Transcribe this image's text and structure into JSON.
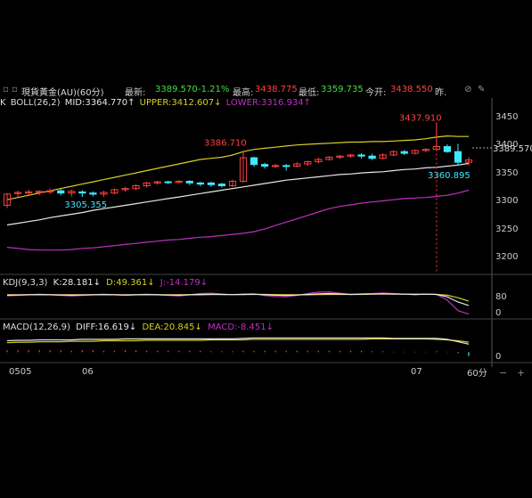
{
  "header": {
    "title": "現貨黃金(AU)(60分)",
    "latest_label": "最新:",
    "latest_value": "3389.570",
    "change_pct": "-1.21%",
    "high_label": "最高:",
    "high_value": "3438.775",
    "low_label": "最低:",
    "low_value": "3359.735",
    "open_label": "今开:",
    "open_value": "3438.550",
    "prev_label": "昨."
  },
  "boll_panel": {
    "k_label": "K",
    "title": "BOLL(26,2)",
    "mid": "MID:3364.770↑",
    "upper": "UPPER:3412.607↓",
    "lower": "LOWER:3316.934↑"
  },
  "kdj_panel": {
    "title": "KDJ(9,3,3)",
    "k": "K:28.181↓",
    "d": "D:49.361↓",
    "j": "J:-14.179↓"
  },
  "macd_panel": {
    "title": "MACD(12,26,9)",
    "diff": "DIFF:16.619↓",
    "dea": "DEA:20.845↓",
    "macd": "MACD:-8.451↓"
  },
  "price_axis_labels": [
    "3450",
    "3400",
    "3350",
    "3300",
    "3250",
    "3200"
  ],
  "kdj_axis_labels": [
    "80",
    "0"
  ],
  "macd_axis_labels": [
    "0"
  ],
  "current_price_tag": "3389.570",
  "x_labels": [
    "0505",
    "06",
    "07"
  ],
  "period_label": "60分",
  "colors": {
    "up": "#ff4040",
    "down": "#40e8ff",
    "upper": "#d8d020",
    "mid": "#e8e8e8",
    "lower": "#c030c0",
    "annot_red": "#ff4040",
    "annot_cyan": "#40e8ff"
  },
  "chart_data": {
    "type": "candlestick",
    "annotations": [
      {
        "label": "3437.910",
        "value": 3437.91,
        "kind": "high"
      },
      {
        "label": "3386.710",
        "value": 3386.71,
        "kind": "high"
      },
      {
        "label": "3305.355",
        "value": 3305.355,
        "kind": "low"
      },
      {
        "label": "3360.895",
        "value": 3360.895,
        "kind": "low"
      }
    ],
    "ylim": [
      3180,
      3470
    ],
    "candles": [
      [
        3290,
        3310,
        3285,
        3312
      ],
      [
        3311,
        3313,
        3305,
        3316
      ],
      [
        3312,
        3314,
        3308,
        3318
      ],
      [
        3313,
        3315,
        3308,
        3317
      ],
      [
        3314,
        3316,
        3310,
        3320
      ],
      [
        3316,
        3312,
        3308,
        3320
      ],
      [
        3312,
        3315,
        3306,
        3318
      ],
      [
        3314,
        3312,
        3305,
        3317
      ],
      [
        3312,
        3310,
        3306,
        3315
      ],
      [
        3310,
        3313,
        3305,
        3316
      ],
      [
        3312,
        3318,
        3310,
        3320
      ],
      [
        3318,
        3320,
        3314,
        3323
      ],
      [
        3320,
        3325,
        3317,
        3327
      ],
      [
        3325,
        3330,
        3322,
        3332
      ],
      [
        3330,
        3332,
        3327,
        3334
      ],
      [
        3332,
        3331,
        3328,
        3334
      ],
      [
        3331,
        3333,
        3329,
        3335
      ],
      [
        3333,
        3330,
        3326,
        3335
      ],
      [
        3330,
        3328,
        3324,
        3332
      ],
      [
        3330,
        3327,
        3323,
        3332
      ],
      [
        3328,
        3325,
        3322,
        3330
      ],
      [
        3325,
        3333,
        3323,
        3336
      ],
      [
        3333,
        3375,
        3331,
        3386
      ],
      [
        3375,
        3363,
        3359,
        3377
      ],
      [
        3363,
        3360,
        3356,
        3366
      ],
      [
        3360,
        3361,
        3357,
        3364
      ],
      [
        3361,
        3360,
        3352,
        3364
      ],
      [
        3360,
        3364,
        3358,
        3367
      ],
      [
        3364,
        3368,
        3361,
        3370
      ],
      [
        3368,
        3372,
        3365,
        3375
      ],
      [
        3372,
        3376,
        3370,
        3378
      ],
      [
        3376,
        3378,
        3373,
        3380
      ],
      [
        3378,
        3380,
        3375,
        3382
      ],
      [
        3380,
        3378,
        3374,
        3383
      ],
      [
        3378,
        3374,
        3371,
        3382
      ],
      [
        3374,
        3380,
        3372,
        3383
      ],
      [
        3380,
        3386,
        3378,
        3388
      ],
      [
        3386,
        3383,
        3380,
        3389
      ],
      [
        3383,
        3388,
        3381,
        3390
      ],
      [
        3388,
        3390,
        3385,
        3392
      ],
      [
        3390,
        3395,
        3388,
        3438
      ],
      [
        3395,
        3386,
        3384,
        3399
      ],
      [
        3386,
        3367,
        3361,
        3400
      ],
      [
        3367,
        3371,
        3361,
        3376
      ]
    ],
    "upper": [
      3300,
      3304,
      3308,
      3312,
      3316,
      3320,
      3324,
      3328,
      3332,
      3336,
      3340,
      3344,
      3348,
      3352,
      3356,
      3360,
      3364,
      3368,
      3372,
      3374,
      3376,
      3380,
      3386,
      3390,
      3392,
      3394,
      3396,
      3398,
      3399,
      3400,
      3401,
      3402,
      3403,
      3403,
      3404,
      3404,
      3405,
      3406,
      3407,
      3409,
      3412,
      3414,
      3413,
      3413
    ],
    "mid": [
      3255,
      3258,
      3261,
      3264,
      3268,
      3271,
      3274,
      3277,
      3281,
      3284,
      3287,
      3290,
      3293,
      3296,
      3299,
      3302,
      3305,
      3308,
      3311,
      3314,
      3317,
      3320,
      3323,
      3326,
      3329,
      3332,
      3335,
      3337,
      3339,
      3341,
      3343,
      3345,
      3346,
      3348,
      3349,
      3350,
      3352,
      3354,
      3355,
      3357,
      3358,
      3360,
      3362,
      3365
    ],
    "lower": [
      3215,
      3213,
      3211,
      3210,
      3210,
      3210,
      3211,
      3213,
      3214,
      3216,
      3218,
      3220,
      3222,
      3224,
      3226,
      3228,
      3229,
      3231,
      3233,
      3234,
      3236,
      3238,
      3240,
      3243,
      3248,
      3254,
      3260,
      3266,
      3272,
      3278,
      3284,
      3288,
      3291,
      3294,
      3296,
      3298,
      3300,
      3302,
      3303,
      3304,
      3306,
      3308,
      3312,
      3317
    ],
    "kdj": {
      "ylim": [
        -20,
        110
      ],
      "k": [
        78,
        79,
        80,
        81,
        80,
        79,
        78,
        79,
        80,
        81,
        80,
        79,
        80,
        81,
        80,
        79,
        78,
        80,
        82,
        83,
        82,
        81,
        82,
        83,
        80,
        78,
        77,
        79,
        82,
        85,
        86,
        84,
        82,
        83,
        84,
        85,
        84,
        83,
        82,
        83,
        82,
        70,
        45,
        28
      ],
      "d": [
        80,
        80,
        80,
        80,
        80,
        80,
        80,
        80,
        80,
        80,
        80,
        80,
        80,
        80,
        80,
        80,
        80,
        80,
        80,
        81,
        81,
        81,
        81,
        82,
        82,
        81,
        80,
        80,
        80,
        81,
        82,
        82,
        82,
        82,
        83,
        83,
        83,
        83,
        83,
        83,
        82,
        78,
        66,
        49
      ],
      "j": [
        75,
        77,
        80,
        83,
        80,
        77,
        74,
        77,
        80,
        83,
        80,
        77,
        80,
        83,
        80,
        77,
        74,
        80,
        86,
        88,
        84,
        81,
        84,
        85,
        76,
        72,
        71,
        77,
        86,
        93,
        94,
        88,
        82,
        85,
        86,
        89,
        86,
        83,
        80,
        83,
        82,
        54,
        3,
        -14
      ]
    },
    "macd": {
      "ylim": [
        -20,
        40
      ],
      "diff": [
        24,
        25,
        25,
        26,
        26,
        26,
        26,
        27,
        27,
        27,
        27,
        28,
        28,
        28,
        28,
        28,
        28,
        28,
        28,
        28,
        28,
        28,
        29,
        30,
        30,
        30,
        30,
        30,
        30,
        30,
        30,
        30,
        30,
        30,
        30,
        30,
        29,
        29,
        29,
        29,
        29,
        27,
        22,
        17
      ],
      "dea": [
        20,
        21,
        21,
        22,
        22,
        22,
        23,
        23,
        23,
        24,
        24,
        24,
        24,
        25,
        25,
        25,
        25,
        25,
        25,
        26,
        26,
        26,
        26,
        27,
        27,
        27,
        27,
        27,
        27,
        27,
        27,
        27,
        27,
        27,
        28,
        28,
        28,
        28,
        28,
        28,
        27,
        26,
        24,
        21
      ],
      "hist": [
        4,
        4,
        4,
        4,
        4,
        4,
        3,
        4,
        4,
        3,
        3,
        4,
        4,
        3,
        3,
        3,
        3,
        3,
        3,
        2,
        2,
        2,
        3,
        3,
        3,
        3,
        3,
        3,
        3,
        3,
        3,
        3,
        3,
        3,
        2,
        2,
        1,
        1,
        1,
        1,
        2,
        1,
        -2,
        -8
      ]
    }
  }
}
